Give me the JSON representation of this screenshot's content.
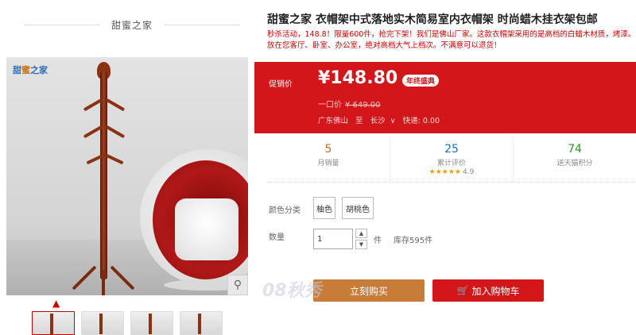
{
  "brand": {
    "name": "甜蜜之家"
  },
  "logo": {
    "text_a": "甜",
    "text_b": "蜜",
    "text_c": "之家"
  },
  "product": {
    "title": "甜蜜之家 衣帽架中式落地实木简易室内衣帽架 时尚蜡木挂衣架包邮",
    "promo": "秒杀活动，148.8！限量600件，抢完下架！我们是佛山厂家。这款衣帽架采用的是高档的白蜡木材质，烤漆。放在您客厅、卧室、办公室，绝对高档大气上档次。不满意可以退货！"
  },
  "price": {
    "label": "促销价",
    "amount": "¥148.80",
    "badge": "年终盛典",
    "orig_label": "一口价",
    "orig_amount": "¥ 649.00",
    "ship_from": "广东佛山",
    "ship_to_word": "至",
    "ship_dest": "长沙",
    "ship_fee": "快递: 0.00"
  },
  "stats": [
    {
      "value": "5",
      "label": "月销量"
    },
    {
      "value": "25",
      "label": "累计评价",
      "rating": "4.9"
    },
    {
      "value": "74",
      "label": "送天猫积分"
    }
  ],
  "options": {
    "color_label": "颜色分类",
    "colors": [
      "柚色",
      "胡桃色"
    ],
    "qty_label": "数量",
    "qty_value": "1",
    "qty_unit": "件",
    "stock": "库存595件"
  },
  "actions": {
    "buy": "立刻购买",
    "cart": "加入购物车"
  },
  "watermark": "08秋秀",
  "icons": {
    "zoom": "magnifier-icon",
    "up": "chevron-up-icon",
    "cart": "cart-icon",
    "star": "star-icon"
  },
  "colors": {
    "accent_red": "#d3161a",
    "buy_orange": "#c77c38"
  }
}
